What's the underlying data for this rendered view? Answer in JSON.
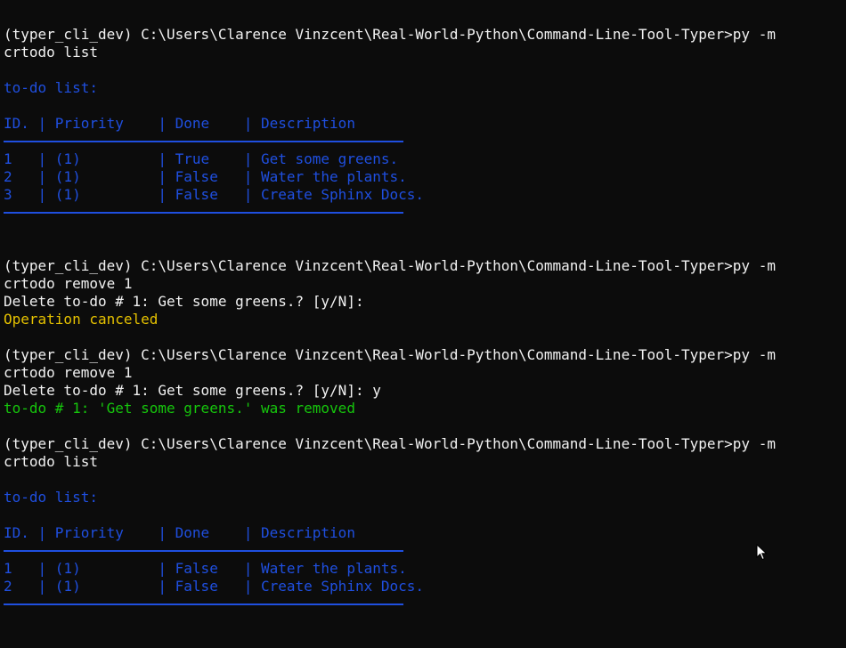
{
  "colors": {
    "background": "#0c0c0c",
    "text": "#f2f2f2",
    "blue": "#1f4fe0",
    "yellow": "#e5c100",
    "green": "#16c60c"
  },
  "terminal": {
    "lines": [
      {
        "text": "(typer_cli_dev) C:\\Users\\Clarence Vinzcent\\Real-World-Python\\Command-Line-Tool-Typer>py -m",
        "color": "white",
        "kind": "prompt"
      },
      {
        "text": "crtodo list",
        "color": "white",
        "kind": "command"
      },
      {
        "text": "",
        "color": "white",
        "kind": "blank"
      },
      {
        "text": "to-do list:",
        "color": "blue",
        "kind": "heading"
      },
      {
        "text": "",
        "color": "white",
        "kind": "blank"
      },
      {
        "text": "ID. | Priority    | Done    | Description",
        "color": "blue",
        "kind": "table-header"
      },
      {
        "text": "",
        "color": "blue",
        "kind": "rule"
      },
      {
        "text": "1   | (1)         | True    | Get some greens.",
        "color": "blue",
        "kind": "table-row"
      },
      {
        "text": "2   | (1)         | False   | Water the plants.",
        "color": "blue",
        "kind": "table-row"
      },
      {
        "text": "3   | (1)         | False   | Create Sphinx Docs.",
        "color": "blue",
        "kind": "table-row"
      },
      {
        "text": "",
        "color": "blue",
        "kind": "rule"
      },
      {
        "text": "",
        "color": "white",
        "kind": "blank"
      },
      {
        "text": "",
        "color": "white",
        "kind": "blank"
      },
      {
        "text": "(typer_cli_dev) C:\\Users\\Clarence Vinzcent\\Real-World-Python\\Command-Line-Tool-Typer>py -m",
        "color": "white",
        "kind": "prompt"
      },
      {
        "text": "crtodo remove 1",
        "color": "white",
        "kind": "command"
      },
      {
        "text": "Delete to-do # 1: Get some greens.? [y/N]:",
        "color": "white",
        "kind": "output"
      },
      {
        "text": "Operation canceled",
        "color": "yellow",
        "kind": "warning"
      },
      {
        "text": "",
        "color": "white",
        "kind": "blank"
      },
      {
        "text": "(typer_cli_dev) C:\\Users\\Clarence Vinzcent\\Real-World-Python\\Command-Line-Tool-Typer>py -m",
        "color": "white",
        "kind": "prompt"
      },
      {
        "text": "crtodo remove 1",
        "color": "white",
        "kind": "command"
      },
      {
        "text": "Delete to-do # 1: Get some greens.? [y/N]: y",
        "color": "white",
        "kind": "output"
      },
      {
        "text": "to-do # 1: 'Get some greens.' was removed",
        "color": "green",
        "kind": "success"
      },
      {
        "text": "",
        "color": "white",
        "kind": "blank"
      },
      {
        "text": "(typer_cli_dev) C:\\Users\\Clarence Vinzcent\\Real-World-Python\\Command-Line-Tool-Typer>py -m",
        "color": "white",
        "kind": "prompt"
      },
      {
        "text": "crtodo list",
        "color": "white",
        "kind": "command"
      },
      {
        "text": "",
        "color": "white",
        "kind": "blank"
      },
      {
        "text": "to-do list:",
        "color": "blue",
        "kind": "heading"
      },
      {
        "text": "",
        "color": "white",
        "kind": "blank"
      },
      {
        "text": "ID. | Priority    | Done    | Description",
        "color": "blue",
        "kind": "table-header"
      },
      {
        "text": "",
        "color": "blue",
        "kind": "rule"
      },
      {
        "text": "1   | (1)         | False   | Water the plants.",
        "color": "blue",
        "kind": "table-row"
      },
      {
        "text": "2   | (1)         | False   | Create Sphinx Docs.",
        "color": "blue",
        "kind": "table-row"
      },
      {
        "text": "",
        "color": "blue",
        "kind": "rule"
      }
    ],
    "cursor_icon": "mouse-pointer-icon"
  }
}
